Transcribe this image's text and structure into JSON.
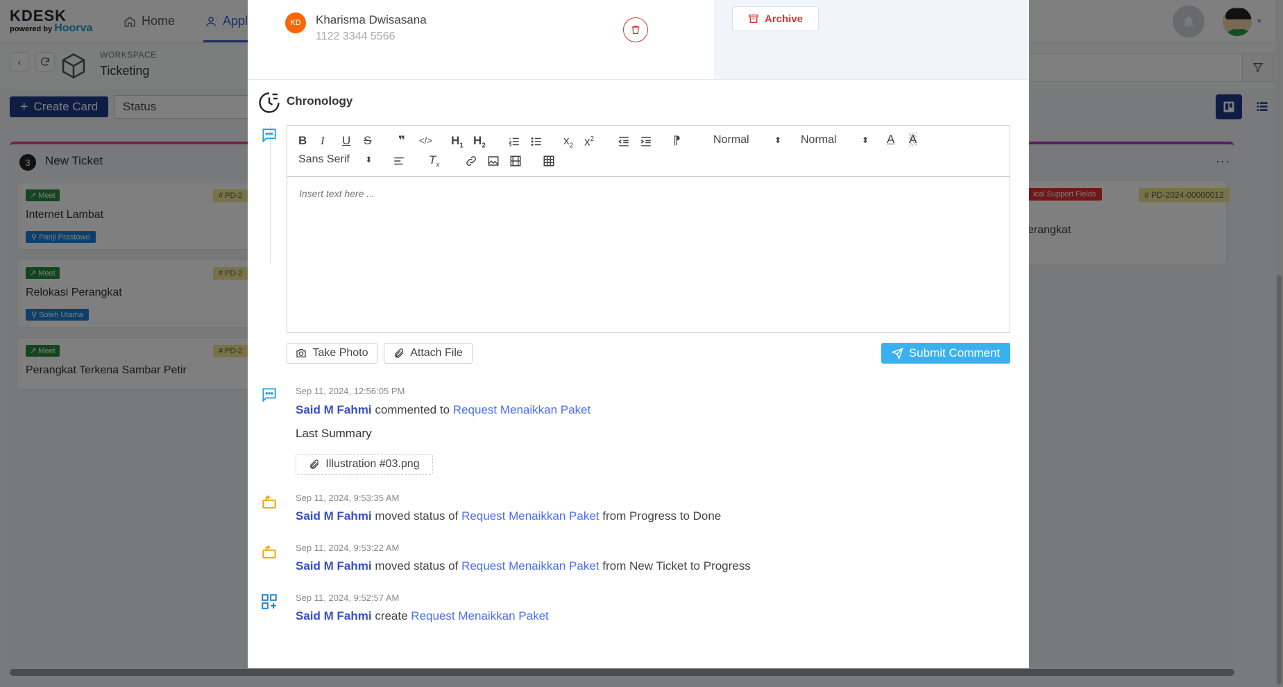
{
  "app": {
    "logo_text": "KDESK",
    "logo_powered": "powered by",
    "logo_brand": "Hoorva",
    "nav_home": "Home",
    "nav_apps": "Appl"
  },
  "workspace": {
    "label": "WORKSPACE",
    "title": "Ticketing"
  },
  "toolbar": {
    "create_card": "Create Card",
    "status_filter": "Status"
  },
  "board": {
    "left_column": {
      "count": "3",
      "title": "New Ticket",
      "tickets": [
        {
          "badge": "Meet",
          "id": "# PD-2",
          "title": "Internet Lambat",
          "assignee": "Panji Prastowo"
        },
        {
          "badge": "Meet",
          "id": "# PD-2",
          "title": "Relokasi Perangkat",
          "assignee": "Soleh Utama"
        },
        {
          "badge": "Meet",
          "id": "# PD-2",
          "title": "Perangkat Terkena Sambar Petir",
          "assignee": ""
        }
      ]
    },
    "right_column": {
      "more": "···",
      "ticket": {
        "badge": "ical Support Fields",
        "id": "# PD-2024-00000012",
        "title": "erangkat"
      }
    }
  },
  "modal": {
    "contact": {
      "initials": "KD",
      "name": "Kharisma Dwisasana",
      "phone": "1122 3344 5566"
    },
    "archive_label": "Archive",
    "chronology_title": "Chronology",
    "editor": {
      "header_select": "Normal",
      "size_select": "Normal",
      "font_select": "Sans Serif",
      "placeholder": "Insert text here ..."
    },
    "take_photo": "Take Photo",
    "attach_file": "Attach File",
    "submit_comment": "Submit Comment",
    "activities": [
      {
        "time": "Sep 11, 2024, 12:56:05 PM",
        "user": "Said M Fahmi",
        "verb": "commented to",
        "target": "Request Menaikkan Paket",
        "rest": "",
        "body": "Last Summary",
        "attachment": "Illustration #03.png"
      },
      {
        "time": "Sep 11, 2024, 9:53:35 AM",
        "user": "Said M Fahmi",
        "verb": "moved status of",
        "target": "Request Menaikkan Paket",
        "rest": "from Progress to Done"
      },
      {
        "time": "Sep 11, 2024, 9:53:22 AM",
        "user": "Said M Fahmi",
        "verb": "moved status of",
        "target": "Request Menaikkan Paket",
        "rest": "from New Ticket to Progress"
      },
      {
        "time": "Sep 11, 2024, 9:52:57 AM",
        "user": "Said M Fahmi",
        "verb": "create",
        "target": "Request Menaikkan Paket",
        "rest": ""
      }
    ]
  },
  "colors": {
    "primary": "#1e3a8a",
    "accent": "#39b1f0",
    "danger": "#e03131",
    "link": "#4c6ef5",
    "orange": "#f59f00"
  }
}
